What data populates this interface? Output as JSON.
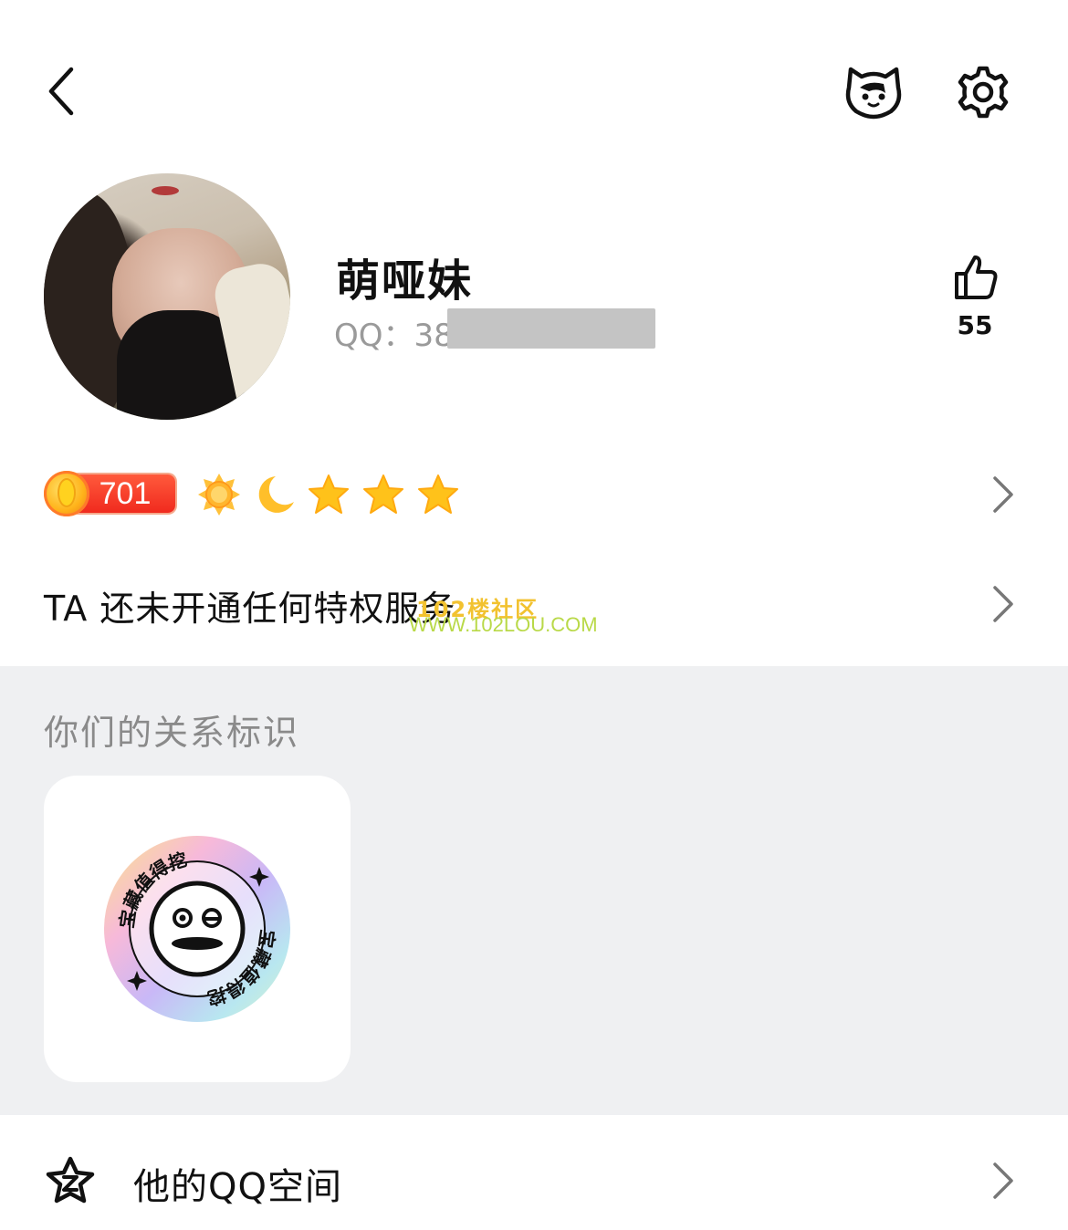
{
  "header": {
    "back_icon": "chevron-left-icon",
    "pet_icon": "pet-face-icon",
    "settings_icon": "gear-icon"
  },
  "profile": {
    "nickname": "萌哑妹",
    "qq_label": "QQ：38",
    "qq_redacted": true,
    "likes": "55",
    "like_icon": "thumbs-up-icon"
  },
  "level": {
    "value": "701",
    "badge_colors": {
      "pill": "#f02a1e",
      "coin": "#ffb31a"
    },
    "icons": [
      "sun-icon",
      "moon-icon",
      "star-icon",
      "star-icon",
      "star-icon"
    ]
  },
  "privileges": {
    "text": "TA 还未开通任何特权服务"
  },
  "watermark": {
    "cn": "102楼社区",
    "en": "WWW.102LOU.COM"
  },
  "relation": {
    "title": "你们的关系标识",
    "badge_text": "宝藏值得挖掘",
    "badge_icon": "treasure-badge-icon"
  },
  "qzone": {
    "label": "他的QQ空间",
    "icon": "qzone-star-icon"
  },
  "colors": {
    "section_bg": "#eff0f2",
    "muted_text": "#8a8a8a",
    "star": "#ffc21a"
  }
}
